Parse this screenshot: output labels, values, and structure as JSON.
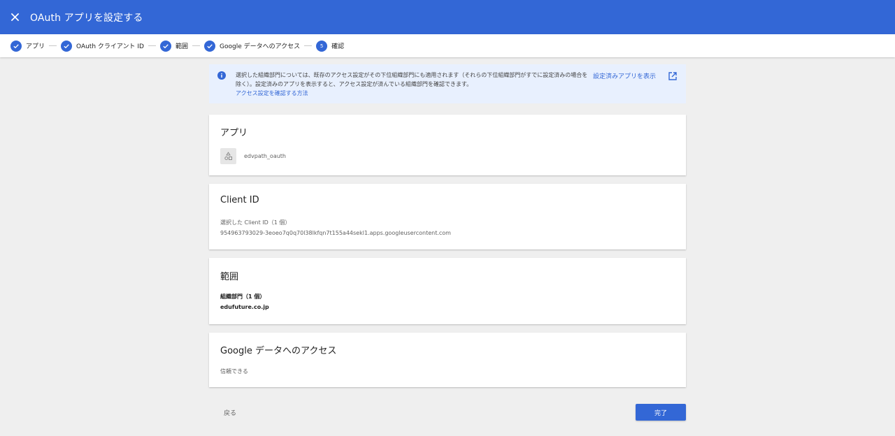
{
  "header": {
    "title": "OAuth アプリを設定する",
    "close_icon": "close-icon",
    "bg_color": "#3367d6"
  },
  "stepper": {
    "steps": [
      {
        "label": "アプリ",
        "state": "done"
      },
      {
        "label": "OAuth クライアント ID",
        "state": "done"
      },
      {
        "label": "範囲",
        "state": "done"
      },
      {
        "label": "Google データへのアクセス",
        "state": "done"
      },
      {
        "label": "確認",
        "state": "current",
        "number": "5"
      }
    ]
  },
  "notice": {
    "icon": "info-icon",
    "text": "選択した組織部門については、既存のアクセス設定がその下位組織部門にも適用されます（それらの下位組織部門がすでに設定済みの場合を除く）。設定済みのアプリを表示すると、アクセス設定が済んでいる組織部門を確認できます。",
    "link": "アクセス設定を確認する方法",
    "action": "設定済みアプリを表示",
    "action_icon": "open-in-new-icon"
  },
  "cards": {
    "app": {
      "title": "アプリ",
      "app_name": "edvpath_oauth",
      "app_icon": "app-shapes-icon"
    },
    "client": {
      "title": "Client ID",
      "label": "選択した Client ID（1 個）",
      "value": "954963793029-3eoeo7q0q70l38lkfqn7t155a44sekl1.apps.googleusercontent.com"
    },
    "scope": {
      "title": "範囲",
      "label": "組織部門（1 個）",
      "value": "edufuture.co.jp"
    },
    "access": {
      "title": "Google データへのアクセス",
      "value": "信頼できる"
    }
  },
  "footer": {
    "back_label": "戻る",
    "done_label": "完了"
  }
}
